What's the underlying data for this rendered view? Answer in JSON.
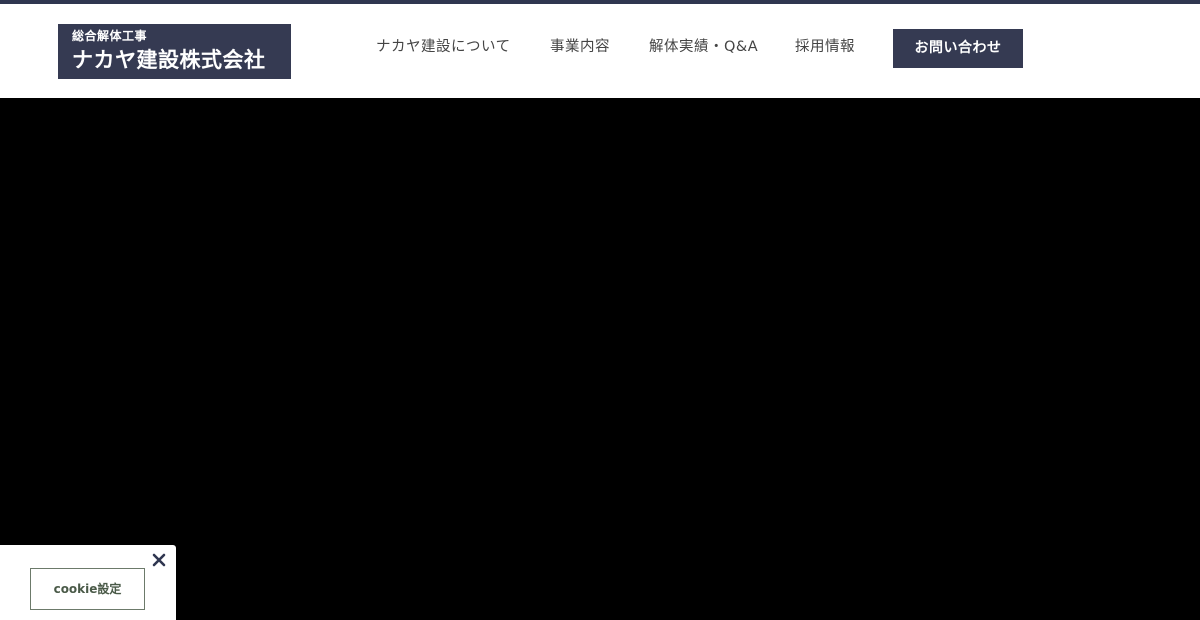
{
  "logo": {
    "subtitle": "総合解体工事",
    "name": "ナカヤ建設株式会社"
  },
  "nav": {
    "items": [
      {
        "label": "ナカヤ建設について"
      },
      {
        "label": "事業内容"
      },
      {
        "label": "解体実績・Q&A"
      },
      {
        "label": "採用情報"
      }
    ],
    "contact_label": "お問い合わせ"
  },
  "cookie": {
    "settings_label": "cookie設定",
    "close_icon": "close-icon"
  },
  "colors": {
    "accent": "#353a52",
    "top_strip": "#2f3650",
    "hero_background": "#000000",
    "header_background": "#ffffff",
    "cookie_border": "#6c7a6a"
  }
}
